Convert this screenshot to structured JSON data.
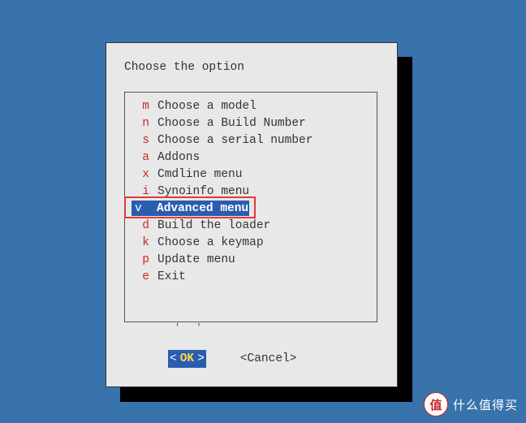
{
  "dialog": {
    "title": "Choose the option",
    "ok_label": "OK",
    "cancel_label": "<Cancel>"
  },
  "menu": {
    "selected_index": 6,
    "items": [
      {
        "key": "m",
        "label": "Choose a model"
      },
      {
        "key": "n",
        "label": "Choose a Build Number"
      },
      {
        "key": "s",
        "label": "Choose a serial number"
      },
      {
        "key": "a",
        "label": "Addons"
      },
      {
        "key": "x",
        "label": "Cmdline menu"
      },
      {
        "key": "i",
        "label": "Synoinfo menu"
      },
      {
        "key": "v",
        "label": "Advanced menu"
      },
      {
        "key": "d",
        "label": "Build the loader"
      },
      {
        "key": "k",
        "label": "Choose a keymap"
      },
      {
        "key": "p",
        "label": "Update menu"
      },
      {
        "key": "e",
        "label": "Exit"
      }
    ]
  },
  "watermark": {
    "badge_char": "值",
    "text": "什么值得买"
  }
}
